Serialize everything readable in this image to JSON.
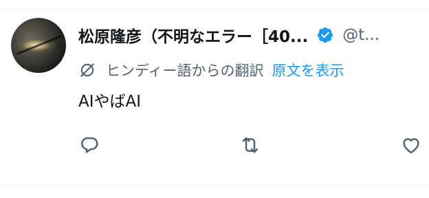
{
  "tweet": {
    "display_name": "松原隆彦（不明なエラー［40...",
    "handle": "@t...",
    "translated_from": "ヒンディー語からの翻訳",
    "show_original": "原文を表示",
    "text": "AIやばAI"
  },
  "icons": {
    "verified": "verified-badge-icon",
    "translate": "translate-icon",
    "reply": "reply-icon",
    "retweet": "retweet-icon",
    "like": "like-icon"
  },
  "colors": {
    "text": "#0f1419",
    "secondary": "#536471",
    "accent": "#1d9bf0",
    "border": "#eff3f4"
  }
}
